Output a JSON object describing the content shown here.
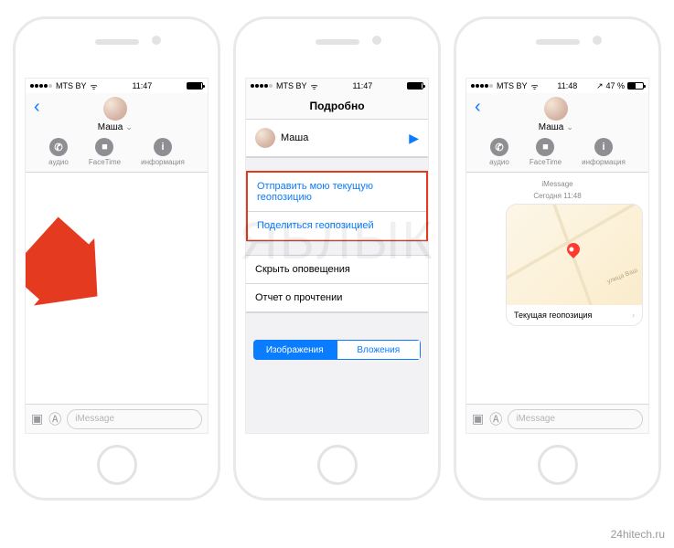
{
  "status": {
    "carrier": "MTS BY",
    "time1": "11:47",
    "time3": "11:48",
    "battery3": "47 %"
  },
  "contact": {
    "name": "Маша"
  },
  "actions": {
    "audio": "аудио",
    "facetime": "FaceTime",
    "info": "информация"
  },
  "input": {
    "placeholder": "iMessage"
  },
  "details": {
    "title": "Подробно",
    "send_location": "Отправить мою текущую геопозицию",
    "share_location": "Поделиться геопозицией",
    "hide_alerts": "Скрыть оповещения",
    "read_receipt": "Отчет о прочтении",
    "seg_images": "Изображения",
    "seg_attach": "Вложения"
  },
  "chat": {
    "header": "iMessage",
    "timestamp": "Сегодня 11:48",
    "street": "улица Ваш",
    "bubble_label": "Текущая геопозиция"
  },
  "watermark": "ЯБЛЫК",
  "credit": "24hitech.ru"
}
